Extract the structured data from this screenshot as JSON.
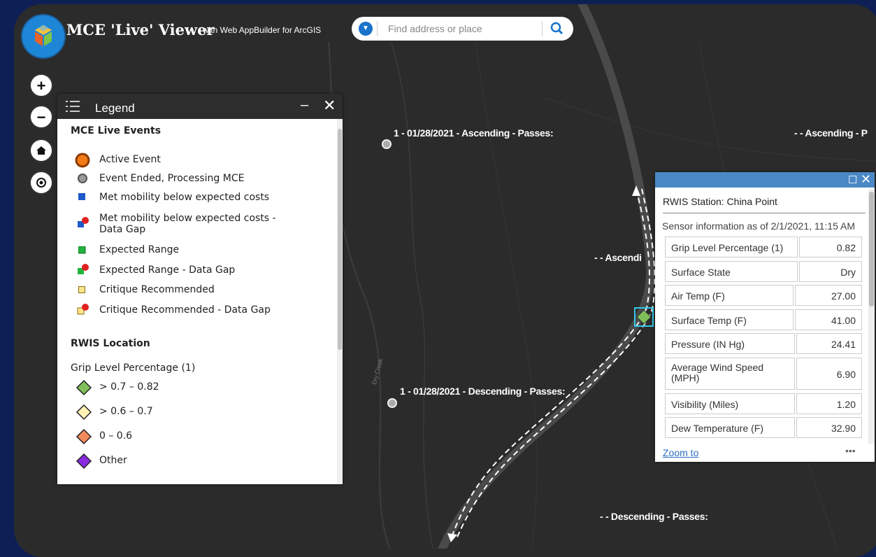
{
  "app": {
    "title": "MCE 'Live' Viewer",
    "subtitle": "with Web AppBuilder for ArcGIS"
  },
  "search": {
    "placeholder": "Find address or place"
  },
  "map_controls": {
    "zoom_in": "+",
    "zoom_out": "−"
  },
  "legend": {
    "title": "Legend",
    "minimize": "–",
    "close": "✕",
    "sections": {
      "live_events": {
        "heading": "MCE Live Events",
        "items": [
          "Active Event",
          "Event Ended, Processing MCE",
          "Met mobility below expected costs",
          "Met mobility below expected costs -",
          "Data Gap",
          "Expected Range",
          "Expected Range - Data Gap",
          "Critique Recommended",
          "Critique Recommended - Data Gap"
        ]
      },
      "rwis": {
        "heading": "RWIS Location",
        "field": "Grip Level Percentage (1)",
        "items": [
          "> 0.7 – 0.82",
          "> 0.6 – 0.7",
          "0 – 0.6",
          "Other"
        ]
      }
    }
  },
  "map_labels": {
    "asc1": "1 - 01/28/2021 - Ascending - Passes:",
    "asc2": "- - Ascending - P",
    "asc3": "- - Ascendi",
    "desc1": "1 - 01/28/2021 - Descending - Passes:",
    "desc2": "- - Descending - Passes:",
    "creek": "Dry Creek"
  },
  "popup": {
    "title": "RWIS Station: China Point",
    "info": "Sensor information as of 2/1/2021, 11:15 AM",
    "rows": [
      {
        "label": "Grip Level Percentage (1)",
        "value": "0.82"
      },
      {
        "label": "Surface State",
        "value": "Dry"
      },
      {
        "label": "Air Temp (F)",
        "value": "27.00"
      },
      {
        "label": "Surface Temp (F)",
        "value": "41.00"
      },
      {
        "label": "Pressure (IN Hg)",
        "value": "24.41"
      },
      {
        "label": "Average Wind Speed",
        "label2": "(MPH)",
        "value": "6.90"
      },
      {
        "label": "Visibility (Miles)",
        "value": "1.20"
      },
      {
        "label": "Dew Temperature (F)",
        "value": "32.90"
      }
    ],
    "zoom_link": "Zoom to",
    "more": "•••"
  },
  "colors": {
    "background": "#0d1f55",
    "map": "#2b2b2b",
    "popup_bar": "#4a88c6",
    "rwis_green": "#7fbf5a",
    "rwis_yellow": "#fff2b3",
    "rwis_orange": "#f08a5d",
    "rwis_other": "#8a2be2"
  }
}
